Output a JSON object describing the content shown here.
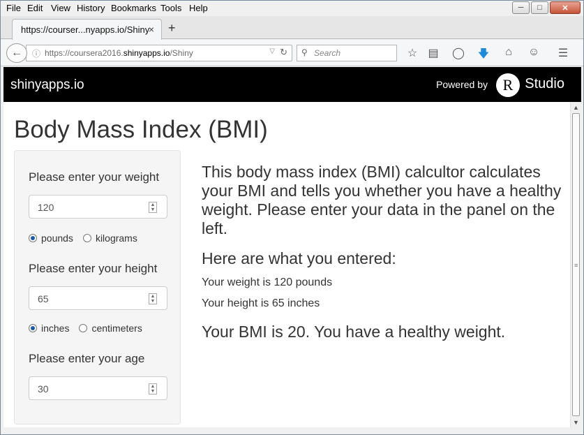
{
  "menu": [
    {
      "key": "F",
      "rest": "ile"
    },
    {
      "key": "E",
      "rest": "dit"
    },
    {
      "key": "V",
      "rest": "iew"
    },
    {
      "key": "",
      "pre": "Hi",
      "key2": "s",
      "rest": "tory"
    },
    {
      "key": "B",
      "rest": "ookmarks"
    },
    {
      "key": "T",
      "rest": "ools"
    },
    {
      "key": "H",
      "rest": "elp"
    }
  ],
  "menu_labels": [
    "File",
    "Edit",
    "View",
    "History",
    "Bookmarks",
    "Tools",
    "Help"
  ],
  "tab": {
    "title": "https://courser...nyapps.io/Shiny",
    "close": "×",
    "new_tab": "+"
  },
  "url": {
    "prefix": "https://coursera2016.",
    "host": "shinyapps.io",
    "path": "/Shiny"
  },
  "search": {
    "placeholder": "Search"
  },
  "header": {
    "brand": "shinyapps.io",
    "powered_by": "Powered by",
    "logo_letter": "R",
    "studio": "Studio"
  },
  "page_title": "Body Mass Index (BMI)",
  "sidebar": {
    "weight_label": "Please enter your weight",
    "weight_value": "120",
    "weight_units": [
      "pounds",
      "kilograms"
    ],
    "height_label": "Please enter your height",
    "height_value": "65",
    "height_units": [
      "inches",
      "centimeters"
    ],
    "age_label": "Please enter your age",
    "age_value": "30"
  },
  "main": {
    "intro": "This body mass index (BMI) calcultor calculates your BMI and tells you whether you have a healthy weight. Please enter your data in the panel on the left.",
    "entered_heading": "Here are what you entered:",
    "weight_line": "Your weight is 120 pounds",
    "height_line": "Your height is 65 inches",
    "bmi_line": "Your BMI is 20. You have a healthy weight."
  }
}
